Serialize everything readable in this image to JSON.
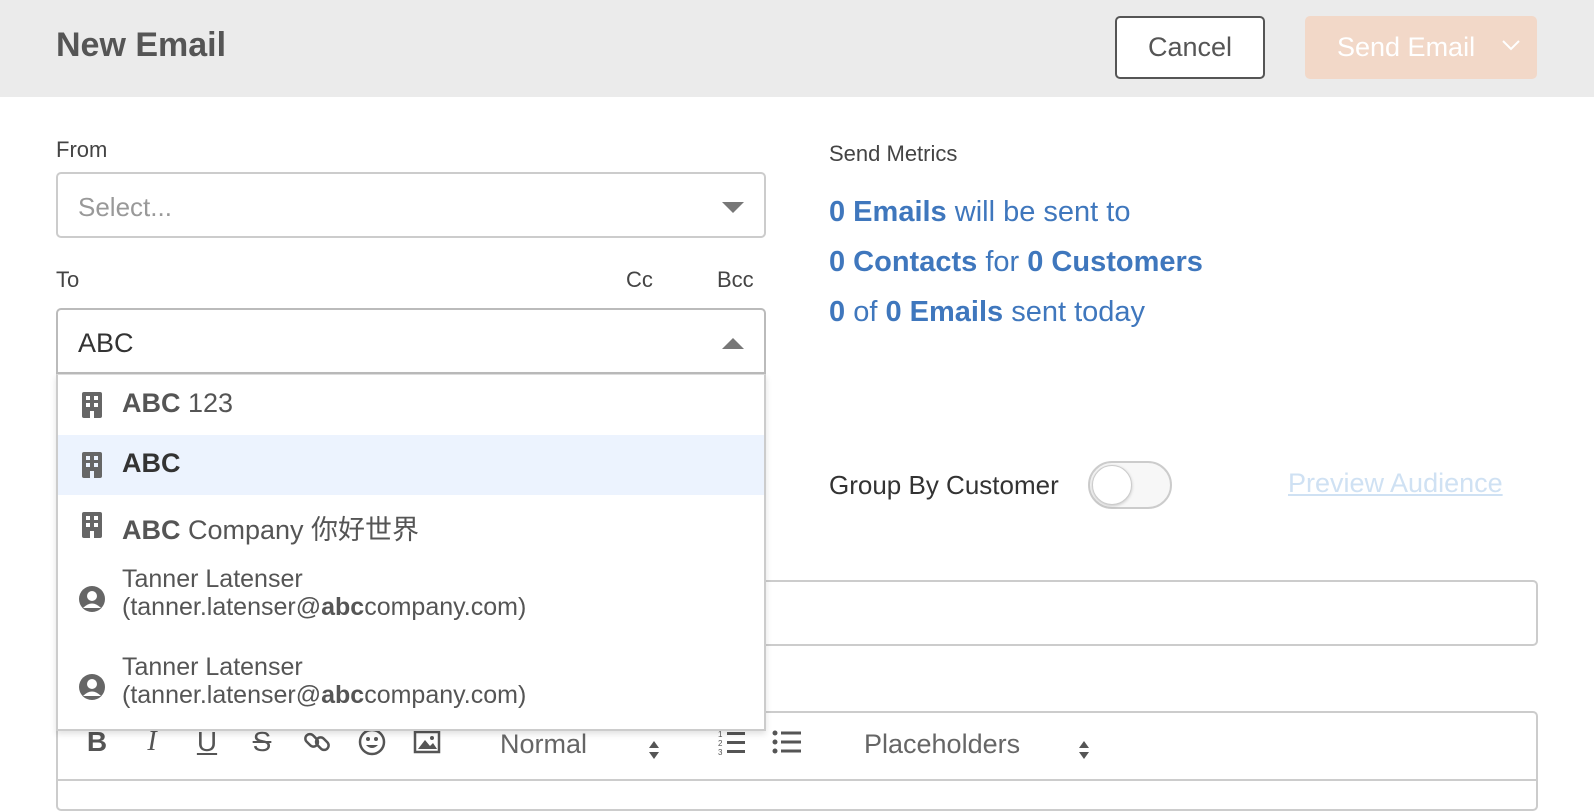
{
  "header": {
    "title": "New Email",
    "cancel_label": "Cancel",
    "send_label": "Send Email"
  },
  "from": {
    "label": "From",
    "placeholder": "Select..."
  },
  "to": {
    "label": "To",
    "cc_label": "Cc",
    "bcc_label": "Bcc",
    "value": "ABC",
    "options": [
      {
        "type": "company",
        "match": "ABC",
        "rest": " 123"
      },
      {
        "type": "company",
        "match": "ABC",
        "rest": "",
        "highlighted": true
      },
      {
        "type": "company",
        "match": "ABC",
        "rest": " Company 你好世界"
      },
      {
        "type": "person",
        "name": "Tanner Latenser",
        "email_prefix": "(tanner.latenser@",
        "email_match": "abc",
        "email_suffix": "company.com)"
      },
      {
        "type": "person",
        "name": "Tanner Latenser",
        "email_prefix": "(tanner.latenser@",
        "email_match": "abc",
        "email_suffix": "company.com)"
      }
    ]
  },
  "metrics": {
    "label": "Send Metrics",
    "line1": {
      "bold": "0 Emails",
      "rest": " will be sent to"
    },
    "line2": {
      "bold1": "0 Contacts",
      "mid": " for ",
      "bold2": "0 Customers"
    },
    "line3": {
      "bold1": "0",
      "mid": " of ",
      "bold2": "0 Emails",
      "rest": " sent today"
    }
  },
  "group_by": {
    "label": "Group By Customer",
    "enabled": false
  },
  "preview_label": "Preview Audience",
  "toolbar": {
    "format_label": "Normal",
    "placeholders_label": "Placeholders"
  },
  "colors": {
    "accent_blue": "#3f77bd",
    "send_disabled": "#f2d8c8",
    "highlight_row": "#ecf3fe"
  }
}
